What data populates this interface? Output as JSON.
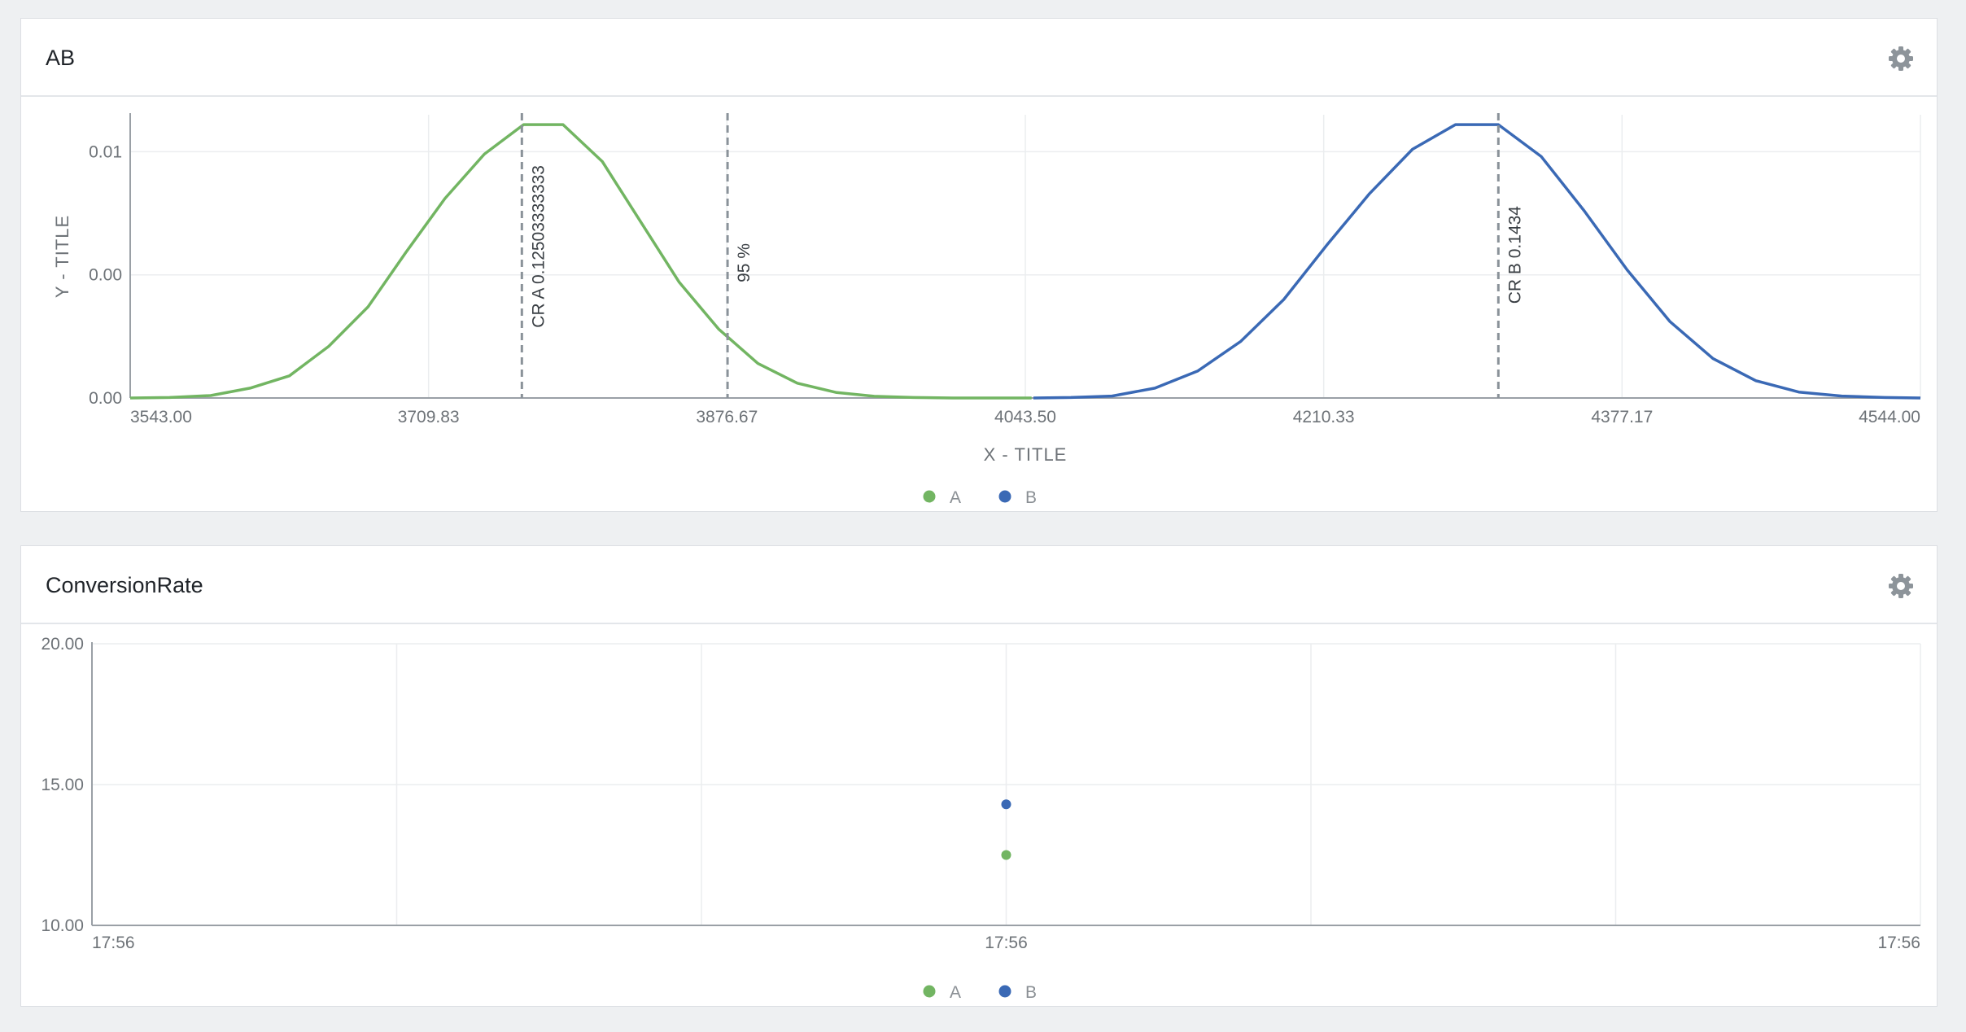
{
  "panels": {
    "ab": {
      "title": "AB"
    },
    "conversion": {
      "title": "ConversionRate"
    }
  },
  "icons": {
    "settings": "gear-icon"
  },
  "colors": {
    "A": "#72b562",
    "B": "#3a69b5",
    "refline": "#8a9299",
    "grid": "#ebedef",
    "axis": "#9aa0a6"
  },
  "chart_data": [
    {
      "type": "line",
      "xlabel": "X - TITLE",
      "ylabel": "Y - TITLE",
      "xlim": [
        3543.0,
        4544.0
      ],
      "ylim": [
        0,
        0.0115
      ],
      "x_ticks": [
        "3543.00",
        "3709.83",
        "3876.67",
        "4043.50",
        "4210.33",
        "4377.17",
        "4544.00"
      ],
      "y_ticks": [
        {
          "value": 0,
          "label": "0.00"
        },
        {
          "value": 0.005,
          "label": "0.00"
        },
        {
          "value": 0.01,
          "label": "0.01"
        }
      ],
      "reference_lines": [
        {
          "x": 3762.0,
          "label": "CR A 0.12503333333"
        },
        {
          "x": 3877.0,
          "label": "95 %"
        },
        {
          "x": 4308.0,
          "label": "CR B 0.1434"
        }
      ],
      "legend": [
        "A",
        "B"
      ],
      "legend_position": "bottom",
      "series": [
        {
          "name": "A",
          "color": "#72b562",
          "x": [
            3543,
            3565,
            3588,
            3610,
            3632,
            3654,
            3676,
            3697,
            3719,
            3741,
            3763,
            3785,
            3807,
            3828,
            3850,
            3872,
            3894,
            3916,
            3938,
            3959,
            3981,
            4003,
            4025,
            4047
          ],
          "y": [
            0.0,
            2e-05,
            0.0001,
            0.0004,
            0.0009,
            0.0021,
            0.0037,
            0.0059,
            0.0081,
            0.0099,
            0.0111,
            0.0111,
            0.0096,
            0.0072,
            0.0047,
            0.0028,
            0.0014,
            0.0006,
            0.00022,
            7e-05,
            2e-05,
            0.0,
            0.0,
            0.0
          ]
        },
        {
          "name": "B",
          "color": "#3a69b5",
          "x": [
            4048,
            4069,
            4092,
            4116,
            4140,
            4164,
            4188,
            4212,
            4236,
            4260,
            4284,
            4308,
            4332,
            4356,
            4380,
            4404,
            4428,
            4452,
            4476,
            4500,
            4524,
            4544
          ],
          "y": [
            0.0,
            2e-05,
            8e-05,
            0.0004,
            0.0011,
            0.0023,
            0.004,
            0.0062,
            0.0083,
            0.0101,
            0.0111,
            0.0111,
            0.0098,
            0.0076,
            0.0052,
            0.0031,
            0.0016,
            0.0007,
            0.00024,
            8e-05,
            2e-05,
            0.0
          ]
        }
      ]
    },
    {
      "type": "scatter",
      "xlabel": "",
      "ylabel": "",
      "ylim": [
        10,
        20
      ],
      "x_ticks": [
        "17:56",
        "17:56",
        "17:56"
      ],
      "y_ticks": [
        {
          "value": 10,
          "label": "10.00"
        },
        {
          "value": 15,
          "label": "15.00"
        },
        {
          "value": 20,
          "label": "20.00"
        }
      ],
      "legend": [
        "A",
        "B"
      ],
      "legend_position": "bottom",
      "series": [
        {
          "name": "A",
          "color": "#72b562",
          "points": [
            {
              "x": "17:56",
              "y": 12.5
            }
          ]
        },
        {
          "name": "B",
          "color": "#3a69b5",
          "points": [
            {
              "x": "17:56",
              "y": 14.3
            }
          ]
        }
      ]
    }
  ]
}
